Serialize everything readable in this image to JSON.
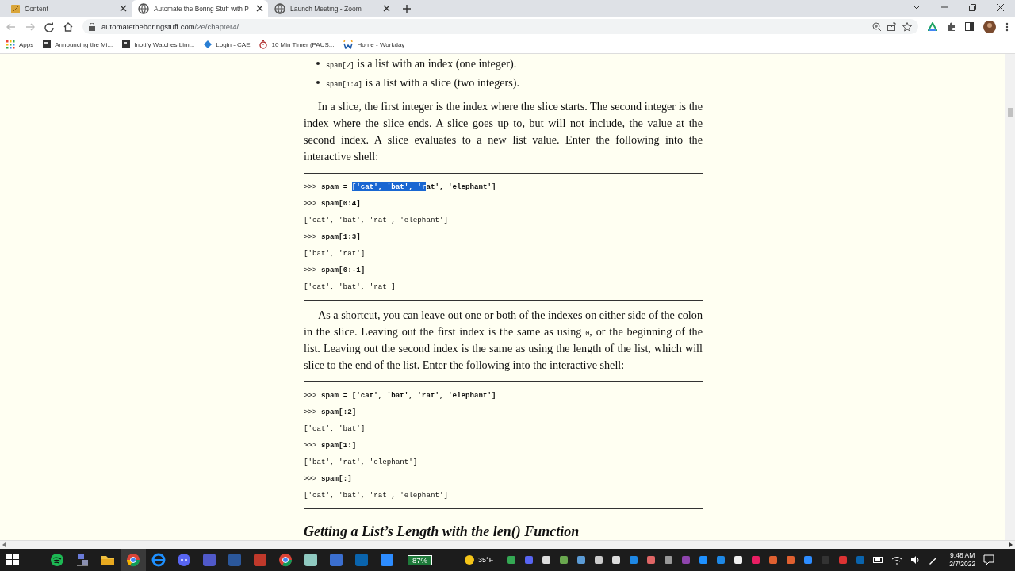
{
  "tabs": [
    {
      "title": "Content",
      "selected": false
    },
    {
      "title": "Automate the Boring Stuff with P",
      "selected": true
    },
    {
      "title": "Launch Meeting - Zoom",
      "selected": false
    }
  ],
  "address": {
    "host": "automatetheboringstuff.com",
    "path": "/2e/chapter4/"
  },
  "bookmarks": [
    {
      "label": "Apps"
    },
    {
      "label": "Announcing the Mi..."
    },
    {
      "label": "Inotify Watches Lim..."
    },
    {
      "label": "Login - CAE"
    },
    {
      "label": "10 Min Timer (PAUS..."
    },
    {
      "label": "Home - Workday"
    }
  ],
  "page": [
    {
      "kind": "bullet",
      "parts": [
        {
          "text": "spam[2]",
          "code": true
        },
        {
          "text": " is a list with an index (one integer).",
          "code": false
        }
      ]
    },
    {
      "kind": "bullet",
      "parts": [
        {
          "text": "spam[1:4]",
          "code": true
        },
        {
          "text": " is a list with a slice (two integers).",
          "code": false
        }
      ]
    },
    {
      "kind": "paragraph",
      "parts": [
        {
          "text": "In a slice, the first integer is the index where the slice starts. The second integer is the index where the slice ends. A slice goes up to, but will not include, the value at the second index. A slice evaluates to a new list value. Enter the following into the interactive shell:",
          "code": false
        }
      ]
    },
    {
      "kind": "code",
      "lines": [
        {
          "kind": "input",
          "prompt": ">>> ",
          "segments": [
            {
              "text": "spam = ",
              "selected": false
            },
            {
              "text": "['cat', 'bat', 'r",
              "selected": true
            },
            {
              "text": "at', 'elephant']",
              "selected": false
            }
          ]
        },
        {
          "kind": "input",
          "prompt": ">>> ",
          "segments": [
            {
              "text": "spam[0:4]",
              "selected": false
            }
          ]
        },
        {
          "kind": "output",
          "segments": [
            {
              "text": "['cat', 'bat', 'rat', 'elephant']",
              "selected": false
            }
          ]
        },
        {
          "kind": "input",
          "prompt": ">>> ",
          "segments": [
            {
              "text": "spam[1:3]",
              "selected": false
            }
          ]
        },
        {
          "kind": "output",
          "segments": [
            {
              "text": "['bat', 'rat']",
              "selected": false
            }
          ]
        },
        {
          "kind": "input",
          "prompt": ">>> ",
          "segments": [
            {
              "text": "spam[0:-1]",
              "selected": false
            }
          ]
        },
        {
          "kind": "output",
          "segments": [
            {
              "text": "['cat', 'bat', 'rat']",
              "selected": false
            }
          ]
        }
      ]
    },
    {
      "kind": "paragraph",
      "parts": [
        {
          "text": "As a shortcut, you can leave out one or both of the indexes on either side of the colon in the slice. Leaving out the first index is the same as using ",
          "code": false
        },
        {
          "text": "0",
          "code": true
        },
        {
          "text": ", or the beginning of the list. Leaving out the second index is the same as using the length of the list, which will slice to the end of the list. Enter the following into the interactive shell:",
          "code": false
        }
      ]
    },
    {
      "kind": "code",
      "lines": [
        {
          "kind": "input",
          "prompt": ">>> ",
          "segments": [
            {
              "text": "spam = ['cat', 'bat', 'rat', 'elephant']",
              "selected": false
            }
          ]
        },
        {
          "kind": "input",
          "prompt": ">>> ",
          "segments": [
            {
              "text": "spam[:2]",
              "selected": false
            }
          ]
        },
        {
          "kind": "output",
          "segments": [
            {
              "text": "['cat', 'bat']",
              "selected": false
            }
          ]
        },
        {
          "kind": "input",
          "prompt": ">>> ",
          "segments": [
            {
              "text": "spam[1:]",
              "selected": false
            }
          ]
        },
        {
          "kind": "output",
          "segments": [
            {
              "text": "['bat', 'rat', 'elephant']",
              "selected": false
            }
          ]
        },
        {
          "kind": "input",
          "prompt": ">>> ",
          "segments": [
            {
              "text": "spam[:]",
              "selected": false
            }
          ]
        },
        {
          "kind": "output",
          "segments": [
            {
              "text": "['cat', 'bat', 'rat', 'elephant']",
              "selected": false
            }
          ]
        }
      ]
    },
    {
      "kind": "heading",
      "text": "Getting a List’s Length with the len() Function"
    }
  ],
  "taskbar": {
    "battery": "87%",
    "weather": "35°F",
    "time": "9:48 AM",
    "date": "2/7/2022"
  }
}
